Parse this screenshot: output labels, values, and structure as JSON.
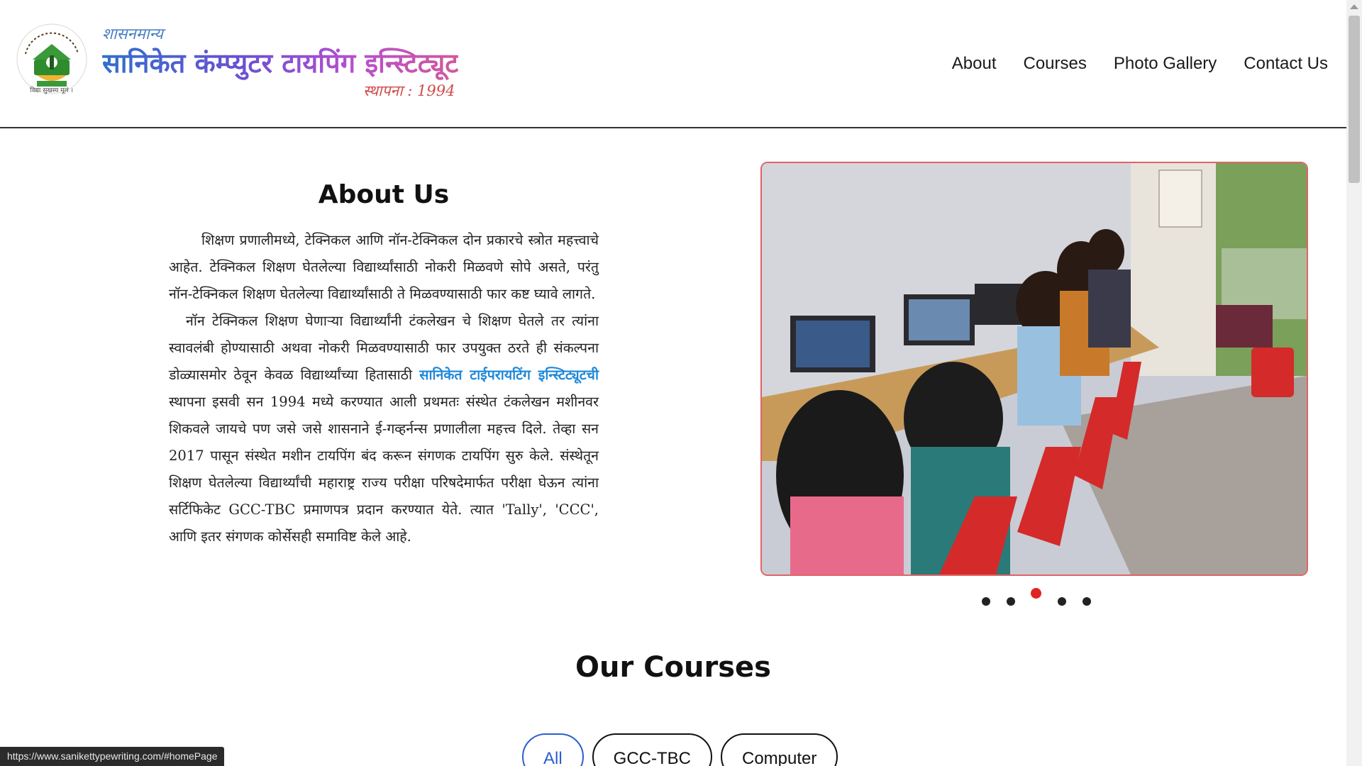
{
  "header": {
    "tagline": "शासनमान्य",
    "brand_name": "सानिकेत कंम्प्युटर टायपिंग इन्स्टिट्यूट",
    "established": "स्थापना : 1994",
    "logo_caption": "विद्या सुखस्य मूलं ।",
    "nav": [
      {
        "label": "About"
      },
      {
        "label": "Courses"
      },
      {
        "label": "Photo Gallery"
      },
      {
        "label": "Contact Us"
      }
    ]
  },
  "about": {
    "title": "About Us",
    "para1": "शिक्षण प्रणालीमध्ये, टेक्निकल आणि नॉन-टेक्निकल दोन प्रकारचे स्त्रोत महत्त्वाचे आहेत. टेक्निकल शिक्षण घेतलेल्या विद्यार्थ्यांसाठी नोकरी मिळवणे सोपे असते, परंतु नॉन-टेक्निकल शिक्षण घेतलेल्या विद्यार्थ्यांसाठी ते मिळवण्यासाठी फार कष्ट घ्यावे लागते.",
    "para2_start": "नॉन टेक्निकल शिक्षण घेणाऱ्या विद्यार्थ्यांनी टंकलेखन चे शिक्षण घेतले तर त्यांना स्वावलंबी होण्यासाठी अथवा नोकरी मिळवण्यासाठी फार उपयुक्त ठरते ही संकल्पना डोळ्यासमोर ठेवून केवळ विद्यार्थ्यांच्या हितासाठी ",
    "para2_highlight": "सानिकेत टाईपरायटिंग इन्स्टिट्यूटची",
    "para2_end": " स्थापना इसवी सन 1994 मध्ये करण्यात आली प्रथमतः संस्थेत टंकलेखन मशीनवर शिकवले जायचे पण जसे जसे शासनाने ई-गव्हर्नन्स प्रणालीला महत्त्व दिले. तेव्हा सन 2017 पासून संस्थेत मशीन टायपिंग बंद करून संगणक टायपिंग सुरु केले. संस्थेतून शिक्षण घेतलेल्या विद्यार्थ्यांची महाराष्ट्र राज्य परीक्षा परिषदेमार्फत परीक्षा घेऊन त्यांना सर्टिफिकेट GCC-TBC प्रमाणपत्र प्रदान करण्यात येते. त्यात 'Tally', 'CCC', आणि इतर संगणक कोर्सेसही समाविष्ट केले आहे."
  },
  "carousel": {
    "slide_count": 5,
    "active_index": 2
  },
  "courses": {
    "title": "Our Courses",
    "filters": [
      {
        "label": "All",
        "active": true
      },
      {
        "label": "GCC-TBC",
        "active": false
      },
      {
        "label": "Computer",
        "active": false
      }
    ]
  },
  "status_url": "https://www.sanikettypewriting.com/#homePage",
  "colors": {
    "accent_link": "#1e88d9",
    "active_dot": "#e02424",
    "carousel_border": "#e06464",
    "active_filter": "#2b5fcf"
  }
}
